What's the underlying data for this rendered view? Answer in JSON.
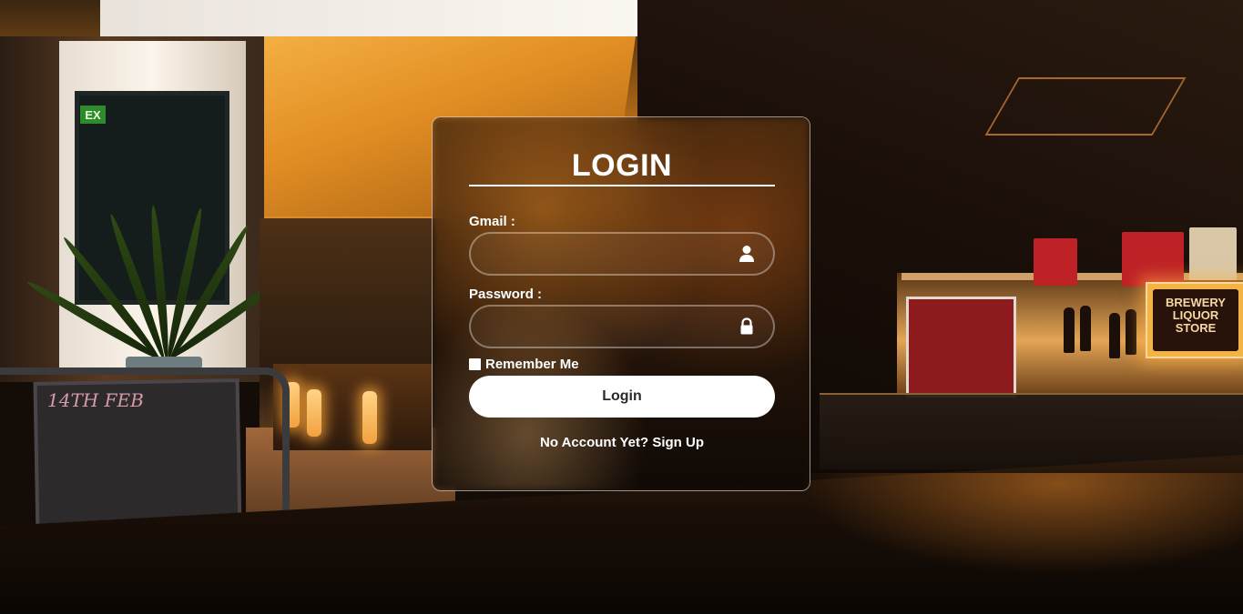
{
  "background": {
    "exit_sign": "EX",
    "chalkboard_text": "14TH FEB",
    "store_sign": [
      "BREWERY",
      "LIQUOR",
      "STORE"
    ]
  },
  "login": {
    "title": "LOGIN",
    "gmail_label": "Gmail :",
    "gmail_value": "",
    "gmail_placeholder": "",
    "gmail_icon": "user-icon",
    "password_label": "Password :",
    "password_value": "",
    "password_placeholder": "",
    "password_icon": "lock-icon",
    "remember_label": "Remember Me",
    "remember_checked": false,
    "submit_label": "Login",
    "signup_text": "No Account Yet? Sign Up"
  },
  "colors": {
    "card_border": "#ffffff",
    "button_bg": "#ffffff",
    "button_text": "#2a2a2a",
    "text": "#ffffff"
  }
}
